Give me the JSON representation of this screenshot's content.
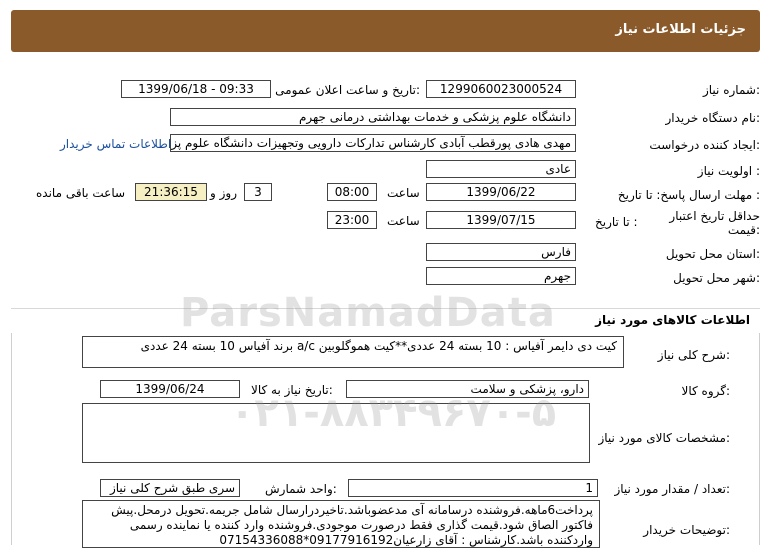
{
  "header": {
    "title": "جزئیات اطلاعات نیاز"
  },
  "fields": {
    "need_number_label": "شماره نیاز:",
    "need_number": "1299060023000524",
    "announce_label": "تاریخ و ساعت اعلان عمومی:",
    "announce_value": "1399/06/18 - 09:33",
    "buyer_label": "نام دستگاه خریدار:",
    "buyer_value": "دانشگاه علوم پزشکی و خدمات بهداشتی درمانی جهرم",
    "creator_label": "ایجاد کننده درخواست:",
    "creator_value": "مهدی هادی پورقطب آبادی کارشناس تدارکات دارویی وتجهیزات دانشگاه علوم پزشکی",
    "contact_link": "اطلاعات تماس خریدار",
    "priority_label": "اولویت نیاز :",
    "priority_value": "عادی",
    "deadline_label": "مهلت ارسال پاسخ:  تا تاریخ :",
    "deadline_date": "1399/06/22",
    "time_label": "ساعت",
    "deadline_time": "08:00",
    "days_value": "3",
    "days_label": "روز و",
    "remaining_time": "21:36:15",
    "remaining_label": "ساعت باقی مانده",
    "validity_label": "حداقل تاریخ اعتبار قیمت:",
    "validity_to_label": "تا تاریخ :",
    "validity_date": "1399/07/15",
    "validity_time_label": "ساعت",
    "validity_time": "23:00",
    "province_label": "استان محل تحویل:",
    "province_value": "فارس",
    "city_label": "شهر محل تحویل:",
    "city_value": "جهرم"
  },
  "goods": {
    "section_title": "اطلاعات کالاهای مورد نیاز",
    "desc_label": "شرح کلی نیاز:",
    "desc_value": "کیت دی دایمر آفیاس : 10 بسته 24 عددی**کیت هموگلوبین a/c برند آفیاس 10 بسته 24 عددی",
    "group_label": "گروه کالا:",
    "group_value": "دارو، پزشکی و سلامت",
    "need_date_label": "تاریخ نیاز به کالا:",
    "need_date_value": "1399/06/24",
    "specs_label": "مشخصات کالای مورد نیاز:",
    "specs_value": "",
    "qty_label": "تعداد / مقدار مورد نیاز:",
    "qty_value": "1",
    "unit_label": "واحد شمارش:",
    "unit_value": "سری طبق شرح کلی نیاز",
    "buyer_notes_label": "توضیحات خریدار:",
    "buyer_notes_value": "پرداخت6ماهه.فروشنده درسامانه آی مدعضوباشد.تاخیردرارسال شامل جریمه.تحویل درمحل.پیش فاکتور الصاق شود.قیمت گذاری فقط درصورت موجودی.فروشنده وارد کننده یا نماینده رسمی واردکننده باشد.کارشناس : آقای زارعیان09177916192*07154336088"
  },
  "watermark": {
    "text": "ParsNamadData",
    "phone": "۰۲۱-۸۸۳۴۹۶۷۰-۵"
  }
}
